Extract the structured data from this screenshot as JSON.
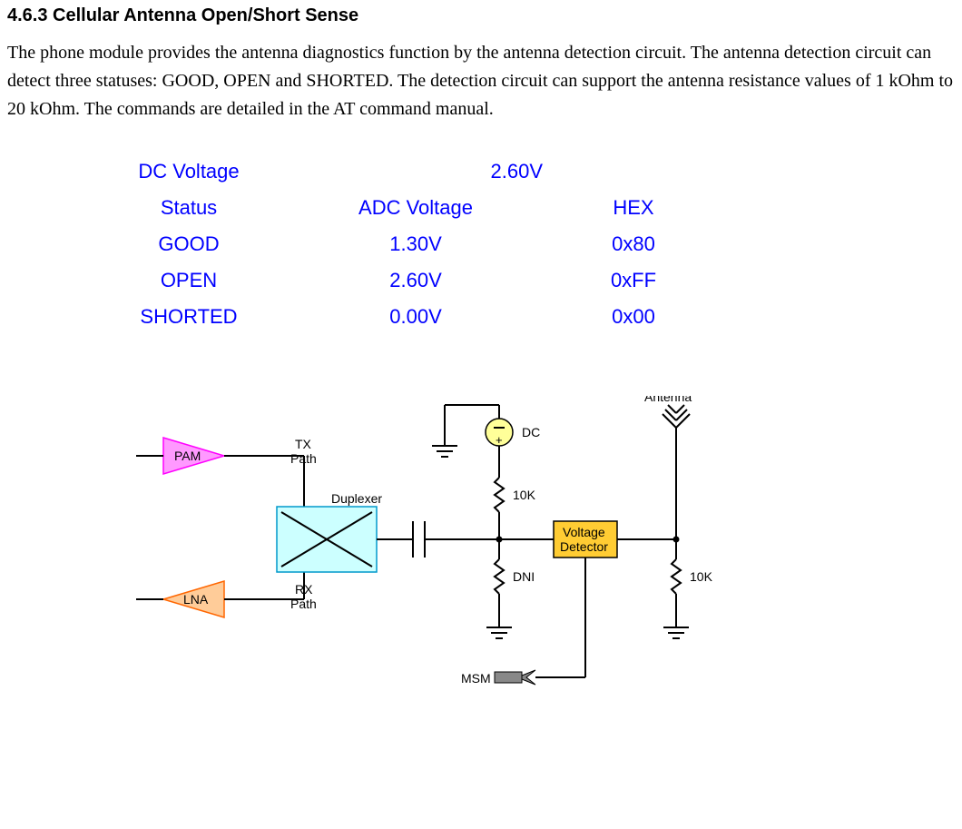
{
  "heading": "4.6.3    Cellular Antenna Open/Short Sense",
  "paragraph": "The phone module provides the antenna diagnostics function by the antenna detection circuit. The antenna detection circuit can detect three statuses: GOOD, OPEN and SHORTED.    The detection circuit can support the antenna resistance values of 1 kOhm to 20 kOhm.    The commands are detailed in the AT command manual.",
  "table": {
    "header1_left": "DC Voltage",
    "header1_right": "2.60V",
    "cols": [
      "Status",
      "ADC Voltage",
      "HEX"
    ],
    "rows": [
      {
        "status": "GOOD",
        "adc": "1.30V",
        "hex": "0x80"
      },
      {
        "status": "OPEN",
        "adc": "2.60V",
        "hex": "0xFF"
      },
      {
        "status": "SHORTED",
        "adc": "0.00V",
        "hex": "0x00"
      }
    ]
  },
  "diagram": {
    "pam": "PAM",
    "lna": "LNA",
    "txpath_l1": "TX",
    "txpath_l2": "Path",
    "rxpath_l1": "RX",
    "rxpath_l2": "Path",
    "duplexer": "Duplexer",
    "dc": "DC",
    "r10k": "10K",
    "dni": "DNI",
    "r10k_2": "10K",
    "antenna": "Antenna",
    "vdet_l1": "Voltage",
    "vdet_l2": "Detector",
    "msm": "MSM"
  }
}
